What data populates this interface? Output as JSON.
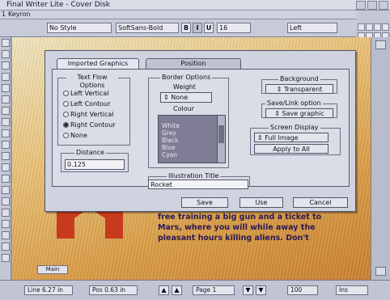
{
  "window": {
    "title": "Final Writer Lite - Cover Disk",
    "doc_title": "Keyron"
  },
  "doc_number": "1",
  "toolbar": {
    "style": "No Style",
    "font": "SoftSans-Bold",
    "bold": "B",
    "italic": "I",
    "underline": "U",
    "size": "16",
    "align": "Left"
  },
  "dialog": {
    "tabs": [
      "Imported Graphics",
      "Position"
    ],
    "text_flow": {
      "label": "Text Flow Options",
      "options": [
        "Left Vertical",
        "Left Contour",
        "Right Vertical",
        "Right Contour",
        "None"
      ],
      "selected": "Right Contour"
    },
    "distance": {
      "label": "Distance",
      "value": "0.125"
    },
    "border": {
      "label": "Border Options",
      "weight_label": "Weight",
      "weight_value": "None",
      "colour_label": "Colour",
      "colours": [
        "White",
        "Grey",
        "Black",
        "Blue",
        "Cyan"
      ]
    },
    "illustration_title": {
      "label": "Illustration Title",
      "value": "Rocket"
    },
    "background": {
      "label": "Background",
      "value": "Transparent"
    },
    "save_link": {
      "label": "Save/Link option",
      "value": "Save graphic"
    },
    "screen_display": {
      "label": "Screen Display",
      "value": "Full Image",
      "apply_all": "Apply to All"
    },
    "buttons": {
      "save": "Save",
      "use": "Use",
      "cancel": "Cancel"
    }
  },
  "document": {
    "text_lines": [
      "free training a big gun and a ticket to",
      "Mars, where you will while away the",
      "pleasant hours killing aliens. Don't"
    ],
    "page_tab": "Main"
  },
  "status": {
    "line": "Line 6.27 in",
    "pos": "Pos 0.63 in",
    "page": "Page 1",
    "zoom": "100",
    "extra": "Ins"
  },
  "colors": {
    "chrome": "#c4c7d6",
    "dialog": "#cfd2df",
    "page_orange": "#d89b45",
    "figure_red": "#c83a1e"
  }
}
